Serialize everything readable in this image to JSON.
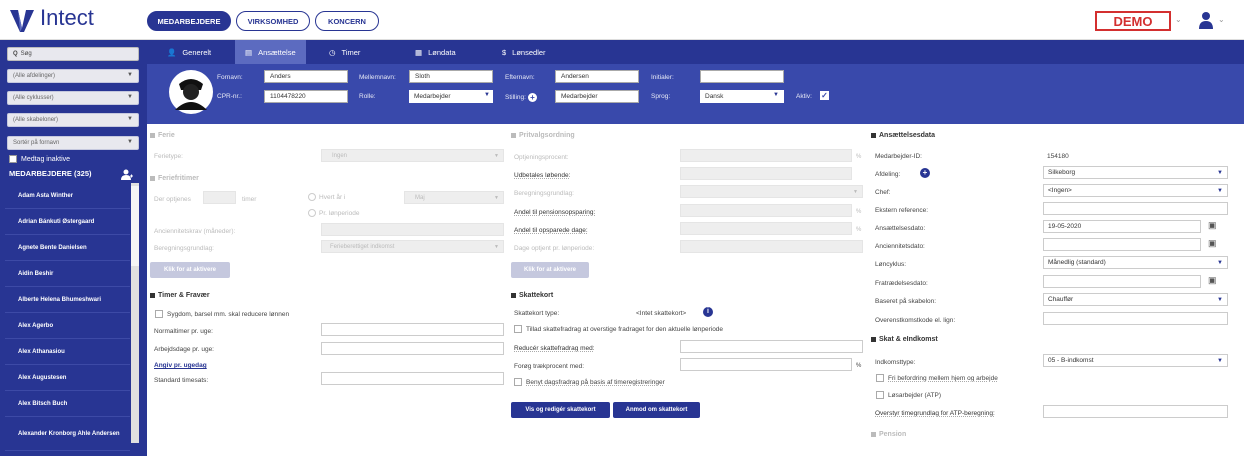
{
  "app": {
    "logo_text": "Intect",
    "demo_label": "DEMO"
  },
  "topnav": [
    "MEDARBEJDERE",
    "VIRKSOMHED",
    "KONCERN"
  ],
  "sidebar": {
    "search_placeholder": "Søg",
    "filters": [
      "(Alle afdelinger)",
      "(Alle cyklusser)",
      "(Alle skabeloner)",
      "Sortér på fornavn"
    ],
    "include_inactive": "Medtag inaktive",
    "employees_header": "MEDARBEJDERE (325)",
    "employees": [
      "Adam Asta Winther",
      "Adrian Bánkuti Østergaard",
      "Agnete Bente Danielsen",
      "Aidin Beshir",
      "Alberte Helena Bhumeshwari",
      "Alex Agerbo",
      "Alex Athanasiou",
      "Alex Augustesen",
      "Alex Bitsch Buch",
      "Alexander Kronborg Ahle Andersen"
    ]
  },
  "tabs": [
    "Generelt",
    "Ansættelse",
    "Timer",
    "Løndata",
    "Lønsedler"
  ],
  "employee": {
    "firstname_label": "Fornavn:",
    "firstname": "Anders",
    "middlename_label": "Mellemnavn:",
    "middlename": "Sloth",
    "lastname_label": "Efternavn:",
    "lastname": "Andersen",
    "initials_label": "Initialer:",
    "initials": "",
    "cpr_label": "CPR-nr.:",
    "cpr": "1104478220",
    "role_label": "Rolle:",
    "role": "Medarbejder",
    "position_label": "Stilling:",
    "position": "Medarbejder",
    "language_label": "Sprog:",
    "language": "Dansk",
    "active_label": "Aktiv:"
  },
  "ferie": {
    "title": "Ferie",
    "type_label": "Ferietype:",
    "type_value": "Ingen",
    "timer_title": "Feriefritimer",
    "earned_label": "Der optjenes",
    "hours_unit": "timer",
    "opt1": "Hvert år i",
    "opt1_month": "Maj",
    "opt2": "Pr. lønperiode",
    "seniority_label": "Anciennitetskrav (måneder):",
    "basis_label": "Beregningsgrundlag:",
    "basis_value": "Ferieberettiget indkomst",
    "activate": "Klik for at aktivere"
  },
  "timer_fravaer": {
    "title": "Timer & Fravær",
    "sick_label": "Sygdom, barsel mm. skal reducere lønnen",
    "normal_hours_label": "Normaltimer pr. uge:",
    "workdays_label": "Arbejdsdage pr. uge:",
    "specify_label": "Angiv pr. ugedag",
    "standard_rates_label": "Standard timesats:"
  },
  "pension": {
    "title": "Pritvalgsordning",
    "rows": [
      "Optjeningsprocent:",
      "Udbetales løbende:",
      "Beregningsgrundlag:",
      "Andel til pensionsopsparing:",
      "Andel til opsparede dage:",
      "Dage optjent pr. lønperiode:"
    ],
    "pct": "%",
    "activate": "Klik for at aktivere"
  },
  "skattekort": {
    "title": "Skattekort",
    "type_label": "Skattekort type:",
    "type_value": "<Intet skattekort>",
    "allow_label": "Tillad skattefradrag at overstige fradraget for den aktuelle lønperiode",
    "reduce_label": "Reducér skattefradrag med:",
    "increase_label": "Forøg trækprocent med:",
    "pct": "%",
    "daily_label": "Benyt dagsfradrag på basis af timeregistreringer",
    "btn_view": "Vis og redigér skattekort",
    "btn_request": "Anmod om skattekort"
  },
  "ansaettelse": {
    "title": "Ansættelsesdata",
    "id_label": "Medarbejder-ID:",
    "id": "154180",
    "dept_label": "Afdeling:",
    "dept": "Silkeborg",
    "boss_label": "Chef:",
    "boss": "<Ingen>",
    "extref_label": "Ekstern reference:",
    "hired_label": "Ansættelsesdato:",
    "hired": "19-05-2020",
    "seniority_label": "Anciennitetsdato:",
    "cycle_label": "Løncyklus:",
    "cycle": "Månedlig (standard)",
    "left_label": "Fratrædelsesdato:",
    "template_label": "Baseret på skabelon:",
    "template": "Chauffør",
    "agreement_label": "Overenstkomstkode el. lign:"
  },
  "skat": {
    "title": "Skat & eIndkomst",
    "income_type_label": "Indkomsttype:",
    "income_type": "05 - B-indkomst",
    "free_transport": "Fri befordring mellem hjem og arbejde",
    "casual_worker": "Løsarbejder (ATP)",
    "atp_override": "Overstyr timegrundlag for ATP-beregning:",
    "pension_title": "Pension"
  }
}
